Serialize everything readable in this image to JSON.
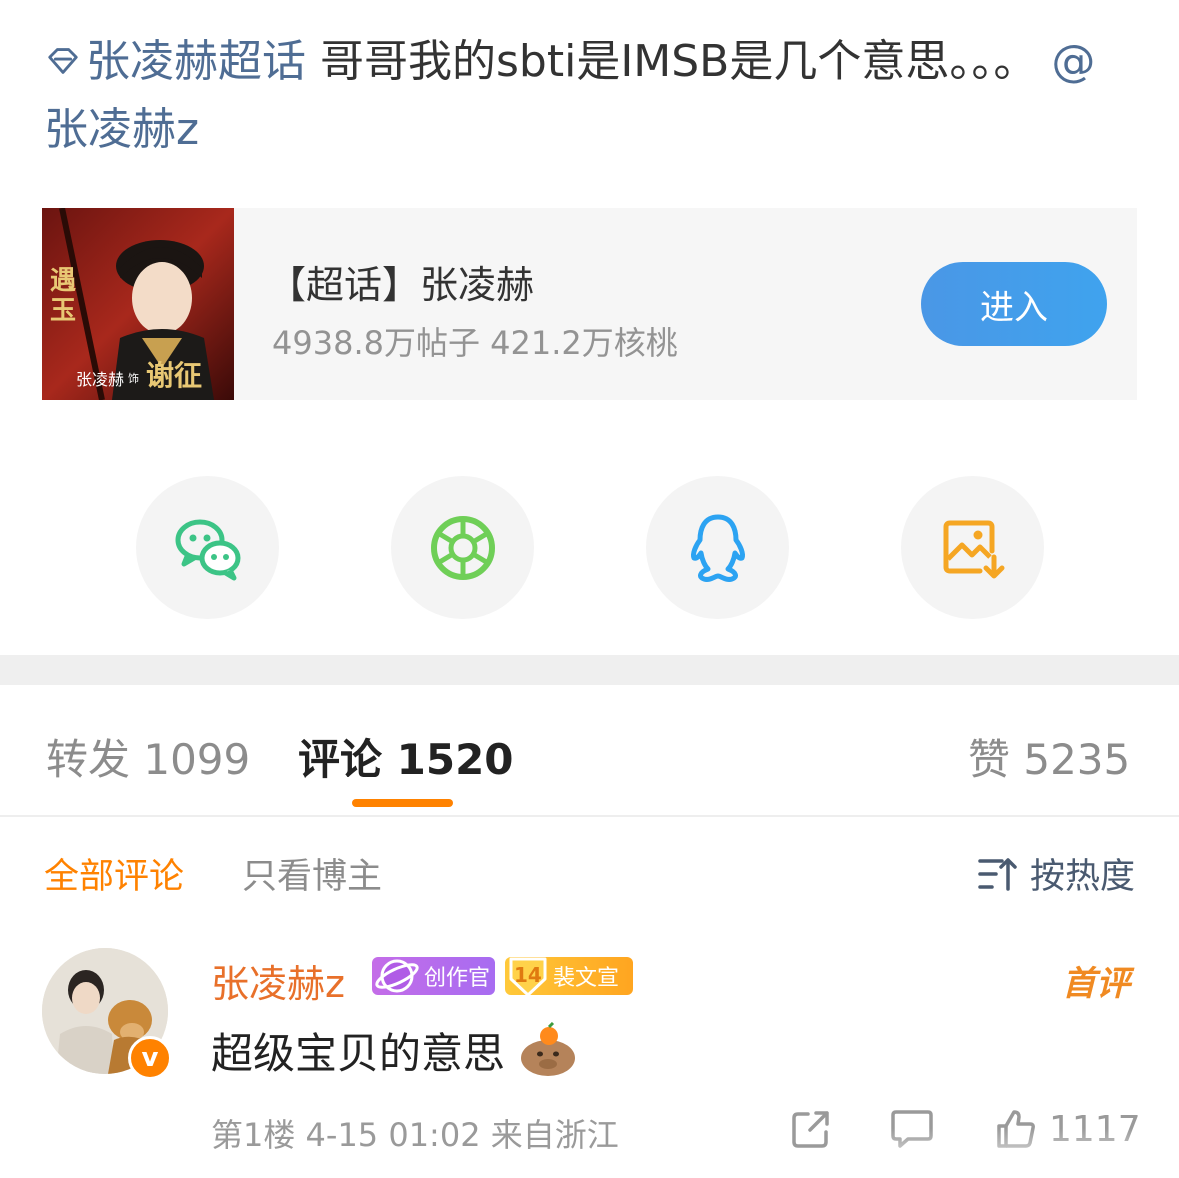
{
  "post": {
    "topic": "张凌赫超话",
    "text": " 哥哥我的sbti是IMSB是几个意思。。。",
    "mention": "@张凌赫z"
  },
  "topic_card": {
    "title": "【超话】张凌赫",
    "stats": "4938.8万帖子  421.2万核桃",
    "enter_label": "进入",
    "cover_text": [
      "遇玉",
      "张凌赫",
      "饰",
      "谢征"
    ]
  },
  "share": [
    {
      "name": "wechat-icon",
      "color": "#3cc486"
    },
    {
      "name": "moments-icon",
      "color": "#6fcf57"
    },
    {
      "name": "qq-icon",
      "color": "#2ca3f2"
    },
    {
      "name": "save-image-icon",
      "color": "#f5a623"
    }
  ],
  "tabs": {
    "repost": "转发 1099",
    "comment": "评论 1520",
    "like": "赞 5235"
  },
  "filters": {
    "all": "全部评论",
    "author_only": "只看博主",
    "sort": "按热度"
  },
  "comment": {
    "author": "张凌赫z",
    "badge_creator": "创作官",
    "badge_fan_level": "14",
    "badge_fan": "裴文宣",
    "first_label": "首评",
    "text": "超级宝贝的意思",
    "meta": "第1楼 4-15 01:02 来自浙江",
    "likes": "1117"
  },
  "colors": {
    "accent_orange": "#ff8200",
    "link_blue": "#4f6d94",
    "enter_button": "#3fa3ee"
  }
}
